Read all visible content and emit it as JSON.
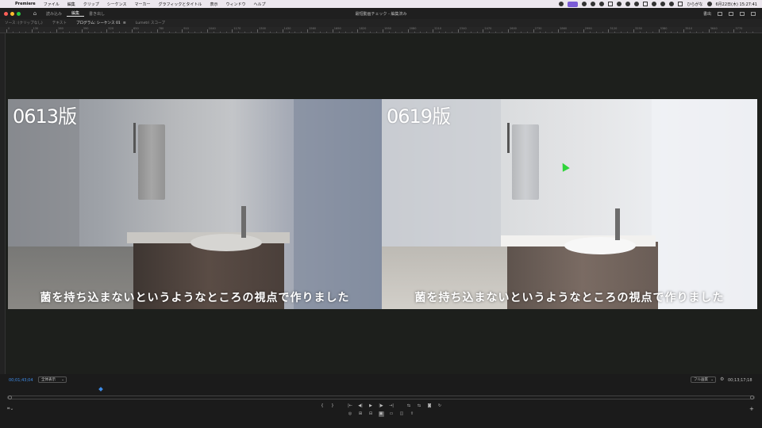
{
  "menubar": {
    "app_name": "Premiere",
    "items": [
      "ファイル",
      "編集",
      "クリップ",
      "シーケンス",
      "マーカー",
      "グラフィックとタイトル",
      "表示",
      "ウィンドウ",
      "ヘルプ"
    ],
    "user_name": "ひらがな",
    "datetime": "6月22日(木) 15:27:41"
  },
  "appbar": {
    "workspaces": [
      "読み込み",
      "編集",
      "書き出し"
    ],
    "active_workspace": "編集",
    "document_title": "最短動画チェック - 編集済み",
    "quick_export": "書出"
  },
  "panel_tabs": [
    {
      "label": "ソース :(クリップなし)",
      "active": false
    },
    {
      "label": "テキスト",
      "active": false
    },
    {
      "label": "プログラム: シーケンス 01",
      "active": true
    },
    {
      "label": "Lumetri スコープ",
      "active": false
    }
  ],
  "ruler_labels": [
    "0",
    "130",
    "260",
    "390",
    "520",
    "650",
    "780",
    "910",
    "1040",
    "1170",
    "1300",
    "1430",
    "1560",
    "1690",
    "1820",
    "1950",
    "2080",
    "2210",
    "2340",
    "2470",
    "2600",
    "2730",
    "2860",
    "2990",
    "3120",
    "3250",
    "3380",
    "3510",
    "3640",
    "3770"
  ],
  "program": {
    "left_version": "0613版",
    "right_version": "0619版",
    "subtitle_left": "菌を持ち込まないというようなところの視点で作りました",
    "subtitle_right": "菌を持ち込まないというようなところの視点で作りました"
  },
  "footer": {
    "timecode_current": "00;01;43;04",
    "fit": "全体表示",
    "quality": "フル画質",
    "timecode_duration": "00;13;17;18",
    "playhead_fraction": 0.125
  },
  "transport": {
    "row1": [
      "{",
      "}",
      "|←",
      "◀|",
      "▶",
      "|▶",
      "→|",
      "⇆",
      "⇆",
      "◙",
      "↻"
    ],
    "row2": [
      "◎",
      "⊞",
      "⊟",
      "▣",
      "▭",
      "◫",
      "⇪"
    ]
  },
  "colors": {
    "accent_timecode": "#3d8ce8",
    "cursor": "#2fd43a"
  }
}
